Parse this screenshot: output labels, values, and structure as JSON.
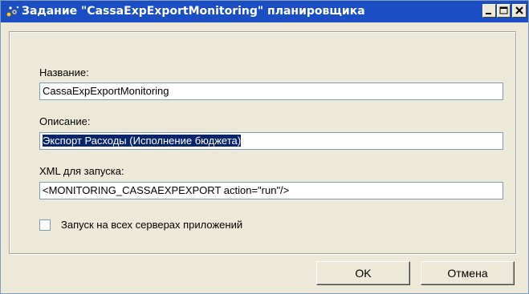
{
  "window": {
    "title": "Задание \"CassaExpExportMonitoring\" планировщика",
    "title_bar_color": "#1c4ec3"
  },
  "title_buttons": {
    "minimize_icon": "minimize-icon",
    "maximize_icon": "maximize-icon",
    "close_icon": "close-icon"
  },
  "form": {
    "name_label": "Название:",
    "name_value": "CassaExpExportMonitoring",
    "description_label": "Описание:",
    "description_value": "Экспорт Расходы (Исполнение бюджета)",
    "xml_label": "XML для запуска:",
    "xml_value": "<MONITORING_CASSAEXPEXPORT action=\"run\"/>",
    "all_servers_label": "Запуск на всех серверах приложений",
    "all_servers_checked": false
  },
  "buttons": {
    "ok": "OK",
    "cancel": "Отмена"
  }
}
